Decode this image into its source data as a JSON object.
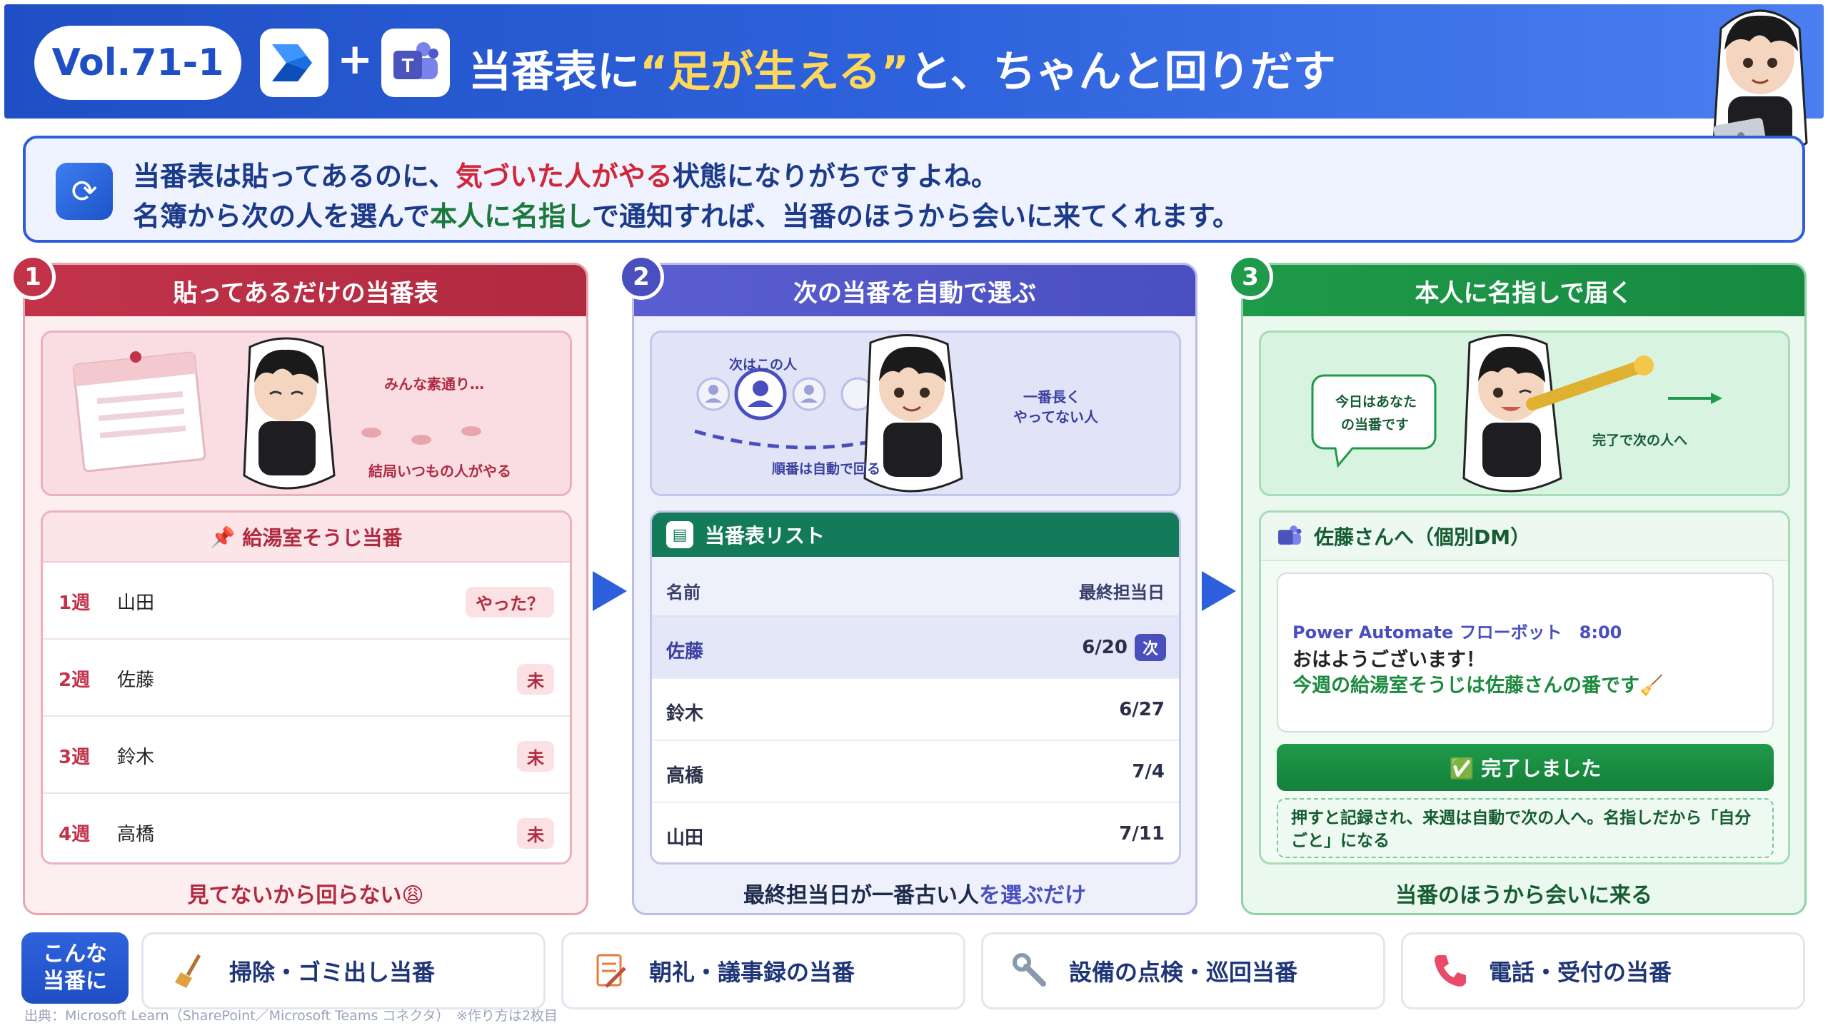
{
  "header": {
    "vol": "Vol.71-1",
    "plus": "+",
    "title_pre": "当番表に",
    "title_hl": "“足が生える”",
    "title_post": "と、ちゃんと回りだす",
    "icon_left": "power-automate-icon",
    "icon_right": "teams-icon"
  },
  "intro": {
    "line1_a": "当番表は貼ってあるのに、",
    "line1_b": "気づいた人がやる",
    "line1_c": "状態になりがちですよね。",
    "line2_a": "名簿から次の人を選んで",
    "line2_b": "本人に名指し",
    "line2_c": "で通知すれば、当番のほうから会いに来てくれます。"
  },
  "panels": [
    {
      "num": "1",
      "title": "貼ってあるだけの当番表",
      "illus_text1": "みんな素通り…",
      "illus_text2": "結局いつもの人がやる",
      "card_title": "給湯室そうじ当番",
      "rows": [
        {
          "week": "1週",
          "name": "山田",
          "tag": "やった？"
        },
        {
          "week": "2週",
          "name": "佐藤",
          "tag": "未"
        },
        {
          "week": "3週",
          "name": "鈴木",
          "tag": "未"
        },
        {
          "week": "4週",
          "name": "高橋",
          "tag": "未"
        }
      ],
      "footer": "見てないから回らない😩"
    },
    {
      "num": "2",
      "title": "次の当番を自動で選ぶ",
      "illus_text1": "次はこの人",
      "illus_text2": "順番は自動で回る",
      "illus_text3": "一番長く",
      "illus_text4": "やってない人",
      "card_title": "当番表リスト",
      "col_name": "名前",
      "col_date": "最終担当日",
      "rows": [
        {
          "name": "佐藤",
          "date": "6/20",
          "tag": "次"
        },
        {
          "name": "鈴木",
          "date": "6/27"
        },
        {
          "name": "高橋",
          "date": "7/4"
        },
        {
          "name": "山田",
          "date": "7/11"
        }
      ],
      "footer_a": "最終担当日が一番古い人",
      "footer_b": "を選ぶだけ"
    },
    {
      "num": "3",
      "title": "本人に名指しで届く",
      "illus_bubble1": "今日はあなた",
      "illus_bubble2": "の当番です",
      "illus_text": "完了で次の人へ",
      "card_title": "佐藤さんへ（個別DM）",
      "msg_from": "Power Automate フローボット　8:00",
      "msg_line1": "おはようございます！",
      "msg_line2": "今週の給湯室そうじは佐藤さんの番です🧹",
      "button": "✅ 完了しました",
      "note": "押すと記録され、来週は自動で次の人へ。名指しだから「自分ごと」になる",
      "footer": "当番のほうから会いに来る"
    }
  ],
  "bottom": {
    "label_line1": "こんな",
    "label_line2": "当番に",
    "chips": [
      {
        "icon": "broom-icon",
        "label": "掃除・ゴミ出し当番"
      },
      {
        "icon": "memo-icon",
        "label": "朝礼・議事録の当番"
      },
      {
        "icon": "wrench-icon",
        "label": "設備の点検・巡回当番"
      },
      {
        "icon": "phone-icon",
        "label": "電話・受付の当番"
      }
    ],
    "source": "出典：Microsoft Learn（SharePoint／Microsoft Teams コネクタ）　※作り方は2枚目"
  },
  "colors": {
    "header_blue": "#1f4fc4",
    "panel1_red": "#c2334a",
    "panel2_indigo": "#4a4fc0",
    "panel3_green": "#1f9a4a",
    "highlight_yellow": "#ffd75a"
  }
}
